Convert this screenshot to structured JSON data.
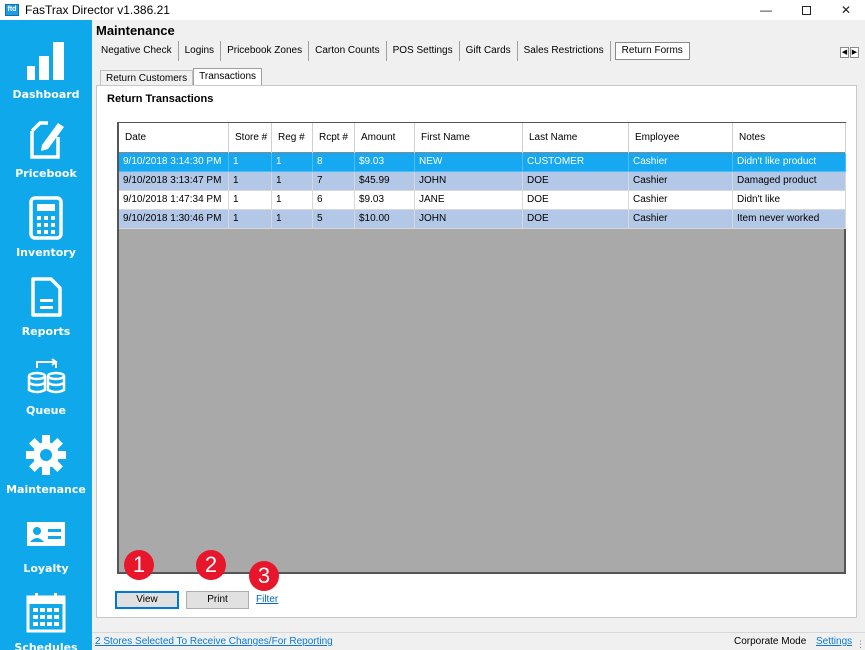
{
  "window": {
    "title": "FasTrax Director v1.386.21",
    "icon_text": "ftd"
  },
  "sidebar": {
    "items": [
      {
        "label": "Dashboard",
        "icon": "bar-chart-icon"
      },
      {
        "label": "Pricebook",
        "icon": "pricebook-icon"
      },
      {
        "label": "Inventory",
        "icon": "calculator-icon"
      },
      {
        "label": "Reports",
        "icon": "document-icon"
      },
      {
        "label": "Queue",
        "icon": "database-sync-icon"
      },
      {
        "label": "Maintenance",
        "icon": "gear-icon"
      },
      {
        "label": "Loyalty",
        "icon": "id-card-icon"
      },
      {
        "label": "Schedules",
        "icon": "calendar-icon"
      }
    ]
  },
  "page": {
    "title": "Maintenance"
  },
  "tabs": [
    "Negative Check",
    "Logins",
    "Pricebook Zones",
    "Carton Counts",
    "POS Settings",
    "Gift Cards",
    "Sales Restrictions",
    "Return Forms"
  ],
  "active_tab": "Return Forms",
  "subtabs": [
    "Return Customers",
    "Transactions"
  ],
  "active_subtab": "Transactions",
  "panel": {
    "title": "Return Transactions"
  },
  "table": {
    "columns": [
      "Date",
      "Store #",
      "Reg #",
      "Rcpt #",
      "Amount",
      "First Name",
      "Last Name",
      "Employee",
      "Notes"
    ],
    "rows": [
      [
        "9/10/2018 3:14:30 PM",
        "1",
        "1",
        "8",
        "$9.03",
        "NEW",
        "CUSTOMER",
        "Cashier",
        "Didn't like product"
      ],
      [
        "9/10/2018 3:13:47 PM",
        "1",
        "1",
        "7",
        "$45.99",
        "JOHN",
        "DOE",
        "Cashier",
        "Damaged product"
      ],
      [
        "9/10/2018 1:47:34 PM",
        "1",
        "1",
        "6",
        "$9.03",
        "JANE",
        "DOE",
        "Cashier",
        "Didn't like"
      ],
      [
        "9/10/2018 1:30:46 PM",
        "1",
        "1",
        "5",
        "$10.00",
        "JOHN",
        "DOE",
        "Cashier",
        "Item never worked"
      ]
    ]
  },
  "actions": {
    "view_label": "View",
    "print_label": "Print",
    "filter_label": "Filter"
  },
  "badges": [
    "1",
    "2",
    "3"
  ],
  "statusbar": {
    "stores_text": "2 Stores Selected To Receive Changes/For Reporting",
    "mode_text": "Corporate Mode",
    "settings_text": "Settings"
  },
  "colors": {
    "sidebar": "#0fa9eb",
    "selected_row": "#16a8f0",
    "alt_row": "#b3c7e6",
    "grid_bg": "#a9a9a9",
    "badge": "#e8162b"
  }
}
